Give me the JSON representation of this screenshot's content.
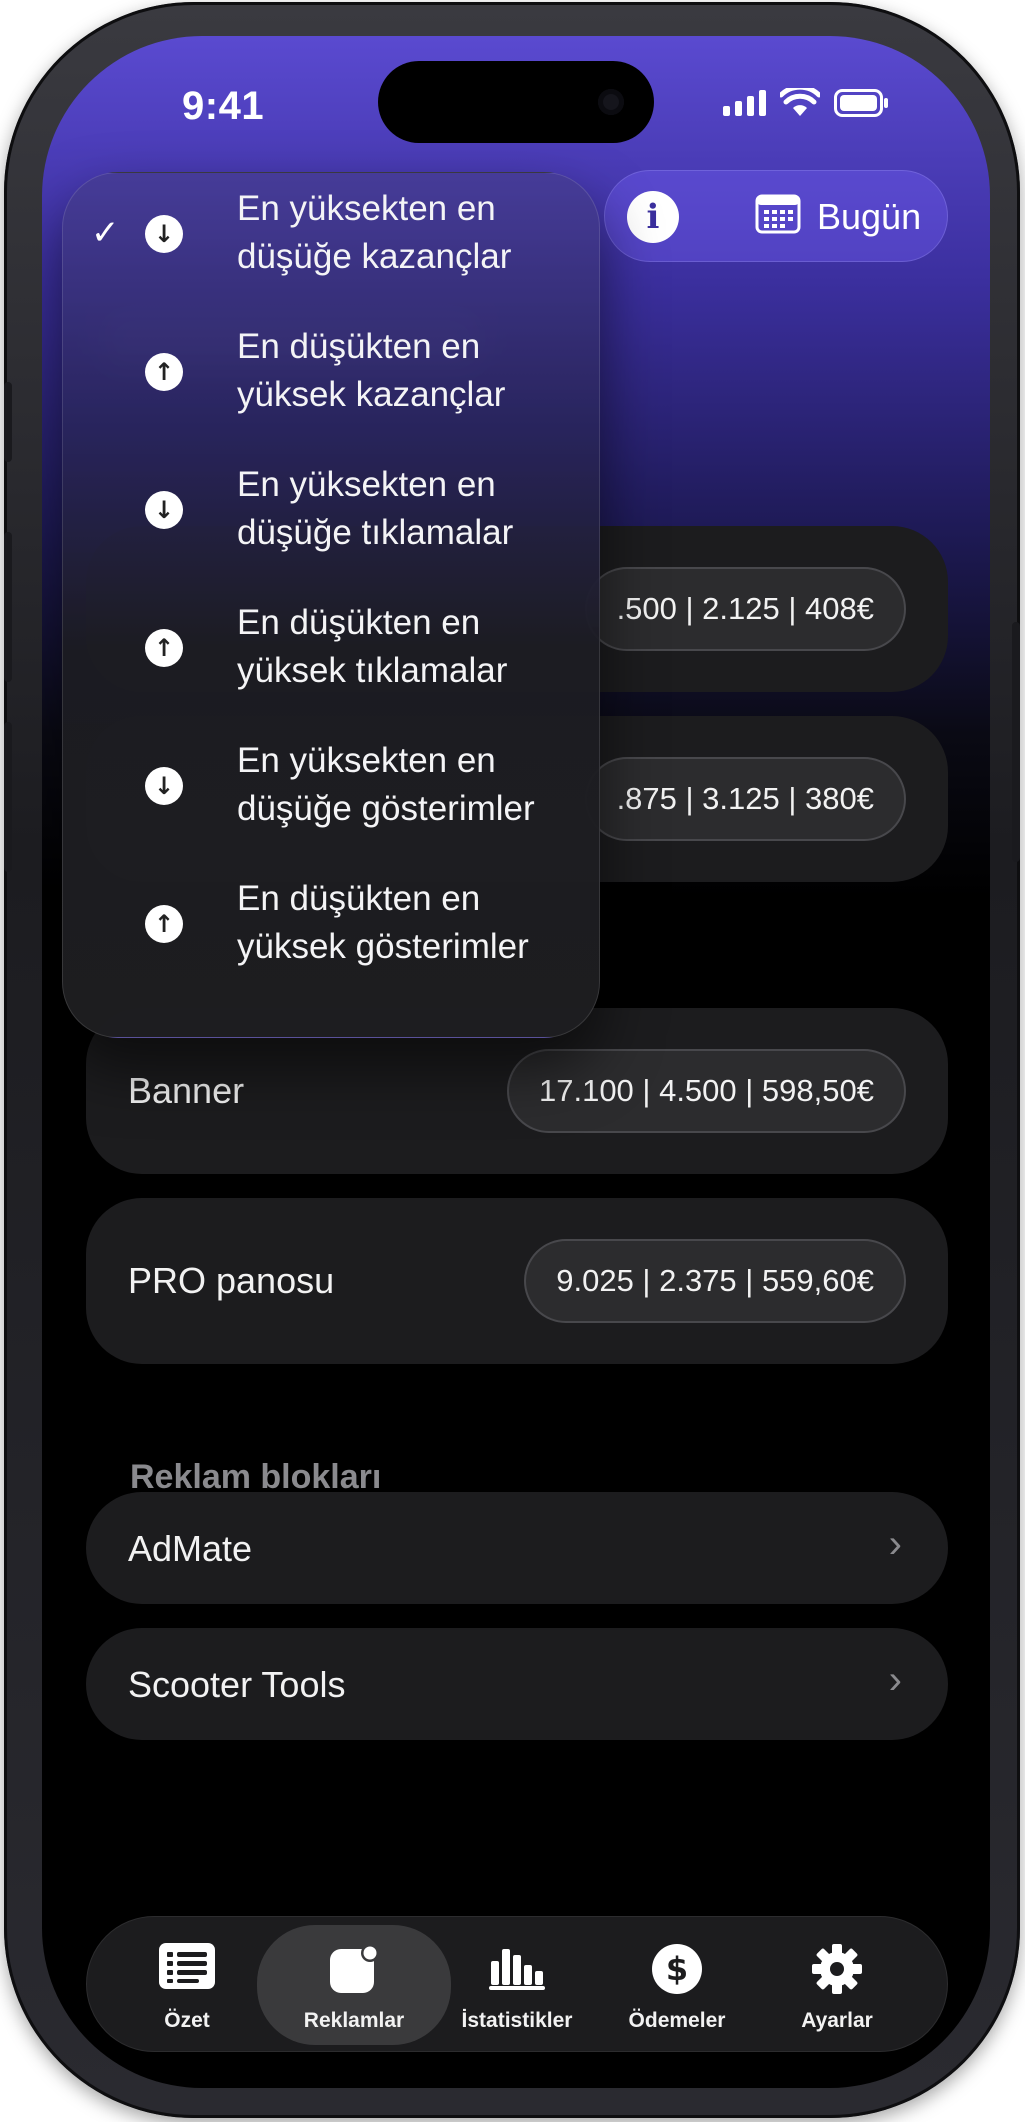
{
  "status_bar": {
    "time": "9:41"
  },
  "header": {
    "date_label": "Bugün"
  },
  "sort_menu": {
    "items": [
      {
        "label": "En yüksekten en düşüğe kazançlar",
        "direction": "down",
        "checked": true
      },
      {
        "label": "En düşükten en yüksek kazançlar",
        "direction": "up",
        "checked": false
      },
      {
        "label": "En yüksekten en düşüğe tıklamalar",
        "direction": "down",
        "checked": false
      },
      {
        "label": "En düşükten en yüksek tıklamalar",
        "direction": "up",
        "checked": false
      },
      {
        "label": "En yüksekten en düşüğe gösterimler",
        "direction": "down",
        "checked": false
      },
      {
        "label": "En düşükten en yüksek gösterimler",
        "direction": "up",
        "checked": false
      }
    ]
  },
  "ad_formats": [
    {
      "label": "",
      "stats": ".500 | 2.125 | 408€"
    },
    {
      "label": "",
      "stats": ".875 | 3.125 | 380€"
    },
    {
      "label": "Banner",
      "stats": "17.100 | 4.500 | 598,50€"
    },
    {
      "label": "PRO panosu",
      "stats": "9.025 | 2.375 | 559,60€"
    }
  ],
  "ad_blocks": {
    "title": "Reklam blokları",
    "items": [
      {
        "label": "AdMate"
      },
      {
        "label": "Scooter Tools"
      }
    ]
  },
  "tab_bar": {
    "tabs": [
      {
        "label": "Özet",
        "icon": "list-icon",
        "active": false
      },
      {
        "label": "Reklamlar",
        "icon": "ads-icon",
        "active": true
      },
      {
        "label": "İstatistikler",
        "icon": "bar-chart-icon",
        "active": false
      },
      {
        "label": "Ödemeler",
        "icon": "dollar-icon",
        "active": false
      },
      {
        "label": "Ayarlar",
        "icon": "gear-icon",
        "active": false
      }
    ]
  },
  "colors": {
    "accent": "#5a4ad0",
    "card": "#1c1c1e",
    "pill": "#2c2c2e"
  }
}
